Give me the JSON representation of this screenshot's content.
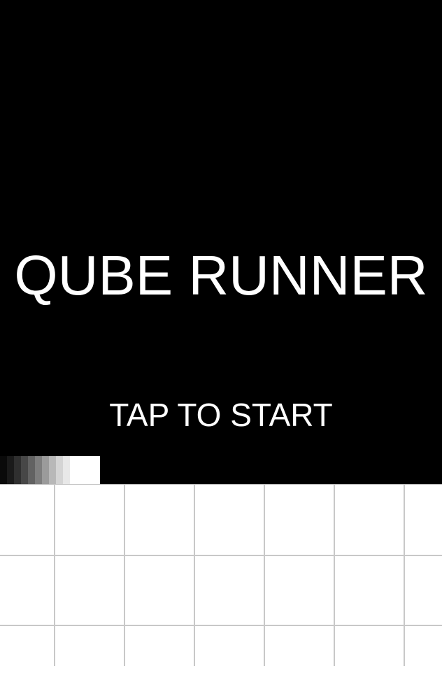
{
  "game": {
    "title": "QUBE RUNNER",
    "start_prompt": "TAP TO START"
  },
  "colors": {
    "sky": "#000000",
    "text": "#ffffff",
    "ground": "#ffffff",
    "grid_line": "#c8c8c8",
    "player": "#ffffff"
  },
  "icons": {
    "player": "player-cube-icon"
  }
}
